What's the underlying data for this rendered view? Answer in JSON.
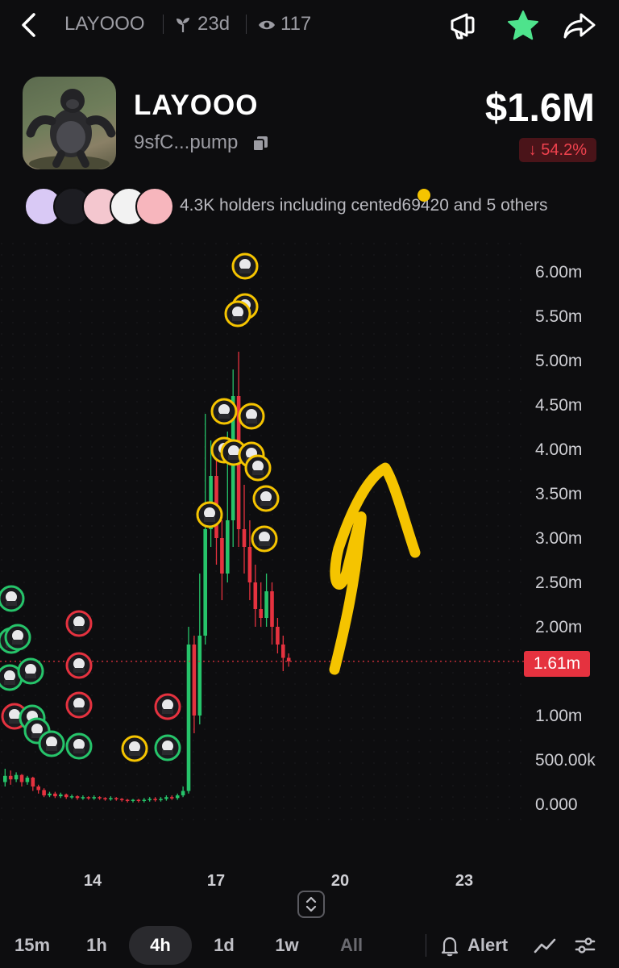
{
  "header": {
    "token_short": "LAYOOO",
    "age": "23d",
    "views": "117"
  },
  "token": {
    "name": "LAYOOO",
    "address": "9sfC...pump",
    "market_cap": "$1.6M",
    "change": "↓ 54.2%"
  },
  "holders": {
    "text": "4.3K holders including cented69420 and 5 others",
    "avatar_colors": [
      "#d9c9f5",
      "#1d1d22",
      "#f4c7cf",
      "#f2f2f2",
      "#f7b6bd"
    ]
  },
  "chart": {
    "current_price_label": "1.61m",
    "colors": {
      "up": "#26c46a",
      "down": "#e5323f",
      "annotation": "#f5c400"
    }
  },
  "chart_data": {
    "type": "candlestick",
    "y_ticks": [
      "6.00m",
      "5.50m",
      "5.00m",
      "4.50m",
      "4.00m",
      "3.50m",
      "3.00m",
      "2.50m",
      "2.00m",
      "1.50m",
      "1.00m",
      "500.00k",
      "0.000"
    ],
    "x_ticks": [
      "14",
      "17",
      "20",
      "23"
    ],
    "ylim": [
      0,
      6000000
    ],
    "current_price": 1610000,
    "candles": [
      {
        "o": 0.25,
        "c": 0.32,
        "h": 0.4,
        "l": 0.2
      },
      {
        "o": 0.32,
        "c": 0.28,
        "h": 0.38,
        "l": 0.22
      },
      {
        "o": 0.28,
        "c": 0.33,
        "h": 0.36,
        "l": 0.25
      },
      {
        "o": 0.33,
        "c": 0.25,
        "h": 0.34,
        "l": 0.2
      },
      {
        "o": 0.25,
        "c": 0.3,
        "h": 0.32,
        "l": 0.22
      },
      {
        "o": 0.3,
        "c": 0.2,
        "h": 0.31,
        "l": 0.15
      },
      {
        "o": 0.2,
        "c": 0.16,
        "h": 0.22,
        "l": 0.12
      },
      {
        "o": 0.16,
        "c": 0.1,
        "h": 0.18,
        "l": 0.08
      },
      {
        "o": 0.1,
        "c": 0.12,
        "h": 0.14,
        "l": 0.08
      },
      {
        "o": 0.12,
        "c": 0.09,
        "h": 0.14,
        "l": 0.07
      },
      {
        "o": 0.09,
        "c": 0.11,
        "h": 0.13,
        "l": 0.07
      },
      {
        "o": 0.11,
        "c": 0.08,
        "h": 0.12,
        "l": 0.06
      },
      {
        "o": 0.08,
        "c": 0.09,
        "h": 0.11,
        "l": 0.06
      },
      {
        "o": 0.09,
        "c": 0.07,
        "h": 0.1,
        "l": 0.05
      },
      {
        "o": 0.07,
        "c": 0.08,
        "h": 0.1,
        "l": 0.05
      },
      {
        "o": 0.08,
        "c": 0.07,
        "h": 0.09,
        "l": 0.05
      },
      {
        "o": 0.07,
        "c": 0.08,
        "h": 0.1,
        "l": 0.05
      },
      {
        "o": 0.08,
        "c": 0.07,
        "h": 0.09,
        "l": 0.05
      },
      {
        "o": 0.07,
        "c": 0.06,
        "h": 0.08,
        "l": 0.04
      },
      {
        "o": 0.06,
        "c": 0.07,
        "h": 0.09,
        "l": 0.04
      },
      {
        "o": 0.07,
        "c": 0.06,
        "h": 0.08,
        "l": 0.04
      },
      {
        "o": 0.06,
        "c": 0.05,
        "h": 0.07,
        "l": 0.03
      },
      {
        "o": 0.05,
        "c": 0.04,
        "h": 0.06,
        "l": 0.02
      },
      {
        "o": 0.04,
        "c": 0.05,
        "h": 0.06,
        "l": 0.02
      },
      {
        "o": 0.05,
        "c": 0.04,
        "h": 0.06,
        "l": 0.02
      },
      {
        "o": 0.04,
        "c": 0.05,
        "h": 0.07,
        "l": 0.02
      },
      {
        "o": 0.05,
        "c": 0.06,
        "h": 0.08,
        "l": 0.03
      },
      {
        "o": 0.06,
        "c": 0.05,
        "h": 0.08,
        "l": 0.03
      },
      {
        "o": 0.05,
        "c": 0.06,
        "h": 0.08,
        "l": 0.03
      },
      {
        "o": 0.06,
        "c": 0.08,
        "h": 0.1,
        "l": 0.04
      },
      {
        "o": 0.08,
        "c": 0.07,
        "h": 0.1,
        "l": 0.05
      },
      {
        "o": 0.07,
        "c": 0.1,
        "h": 0.12,
        "l": 0.05
      },
      {
        "o": 0.1,
        "c": 0.15,
        "h": 0.2,
        "l": 0.08
      },
      {
        "o": 0.15,
        "c": 1.8,
        "h": 2.0,
        "l": 0.12
      },
      {
        "o": 1.8,
        "c": 1.0,
        "h": 1.9,
        "l": 0.8
      },
      {
        "o": 1.0,
        "c": 1.9,
        "h": 2.6,
        "l": 0.9
      },
      {
        "o": 1.9,
        "c": 3.1,
        "h": 4.4,
        "l": 1.8
      },
      {
        "o": 3.1,
        "c": 3.7,
        "h": 4.1,
        "l": 2.9
      },
      {
        "o": 3.7,
        "c": 3.0,
        "h": 3.9,
        "l": 2.7
      },
      {
        "o": 3.0,
        "c": 2.6,
        "h": 3.2,
        "l": 2.3
      },
      {
        "o": 2.6,
        "c": 3.2,
        "h": 4.2,
        "l": 2.5
      },
      {
        "o": 3.2,
        "c": 4.6,
        "h": 4.9,
        "l": 2.9
      },
      {
        "o": 4.6,
        "c": 3.1,
        "h": 5.1,
        "l": 2.9
      },
      {
        "o": 3.1,
        "c": 2.9,
        "h": 3.6,
        "l": 2.6
      },
      {
        "o": 2.9,
        "c": 2.5,
        "h": 3.2,
        "l": 2.3
      },
      {
        "o": 2.5,
        "c": 2.2,
        "h": 2.7,
        "l": 2.0
      },
      {
        "o": 2.2,
        "c": 2.1,
        "h": 2.5,
        "l": 2.0
      },
      {
        "o": 2.1,
        "c": 2.4,
        "h": 2.6,
        "l": 2.0
      },
      {
        "o": 2.4,
        "c": 2.0,
        "h": 2.5,
        "l": 1.8
      },
      {
        "o": 2.0,
        "c": 1.8,
        "h": 2.1,
        "l": 1.7
      },
      {
        "o": 1.8,
        "c": 1.65,
        "h": 1.9,
        "l": 1.5
      },
      {
        "o": 1.65,
        "c": 1.61,
        "h": 1.7,
        "l": 1.55
      }
    ]
  },
  "timeframes": [
    "15m",
    "1h",
    "4h",
    "1d",
    "1w",
    "All"
  ],
  "active_timeframe": "4h",
  "toolbar": {
    "alert_label": "Alert"
  }
}
